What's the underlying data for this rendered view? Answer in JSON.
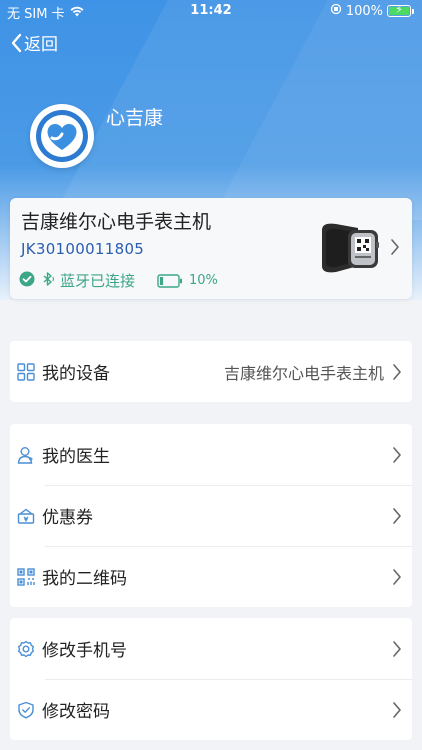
{
  "status_bar": {
    "carrier": "无 SIM 卡",
    "time": "11:42",
    "battery_percent": "100%",
    "icons": [
      "wifi-icon",
      "orientation-lock-icon",
      "battery-charging-icon"
    ]
  },
  "nav": {
    "back_label": "返回"
  },
  "profile": {
    "app_name": "心吉康"
  },
  "device": {
    "name": "吉康维尔心电手表主机",
    "id": "JK30100011805",
    "bluetooth_status": "蓝牙已连接",
    "battery": "10%",
    "battery_level": 0.1
  },
  "menu_groups": [
    {
      "items": [
        {
          "label": "我的设备",
          "value": "吉康维尔心电手表主机",
          "icon": "grid-icon"
        }
      ]
    },
    {
      "items": [
        {
          "label": "我的医生",
          "icon": "doctor-icon"
        },
        {
          "label": "优惠券",
          "icon": "coupon-icon"
        },
        {
          "label": "我的二维码",
          "icon": "qrcode-icon"
        }
      ]
    },
    {
      "items": [
        {
          "label": "修改手机号",
          "icon": "settings-gear-icon"
        },
        {
          "label": "修改密码",
          "icon": "shield-icon"
        }
      ]
    }
  ],
  "colors": {
    "header_blue": "#3f93e6",
    "accent_green": "#3ca687",
    "device_id_blue": "#2a5db0",
    "icon_blue": "#4a8fd6"
  }
}
